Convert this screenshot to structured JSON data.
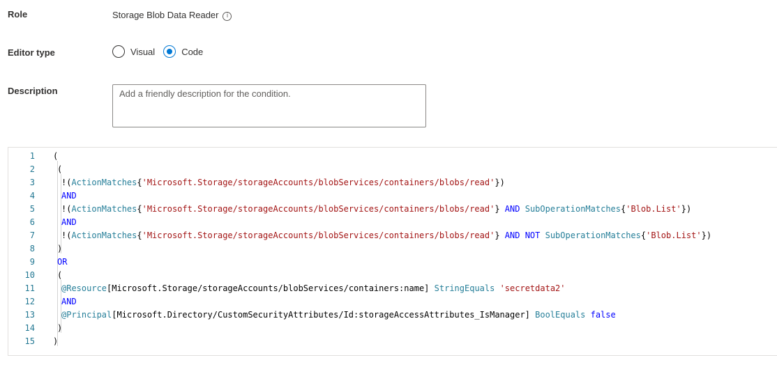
{
  "role": {
    "label": "Role",
    "value": "Storage Blob Data Reader",
    "info_icon": "info-icon"
  },
  "editor_type": {
    "label": "Editor type",
    "options": [
      "Visual",
      "Code"
    ],
    "selected": "Code"
  },
  "description": {
    "label": "Description",
    "placeholder": "Add a friendly description for the condition.",
    "value": ""
  },
  "code_editor": {
    "lines": [
      {
        "n": "1",
        "indent": 0,
        "tokens": [
          [
            "pun",
            "("
          ]
        ]
      },
      {
        "n": "2",
        "indent": 1,
        "tokens": [
          [
            "pun",
            "("
          ]
        ]
      },
      {
        "n": "3",
        "indent": 2,
        "tokens": [
          [
            "pun",
            "!("
          ],
          [
            "fn",
            "ActionMatches"
          ],
          [
            "pun",
            "{"
          ],
          [
            "str",
            "'Microsoft.Storage/storageAccounts/blobServices/containers/blobs/read'"
          ],
          [
            "pun",
            "})"
          ]
        ]
      },
      {
        "n": "4",
        "indent": 2,
        "tokens": [
          [
            "kw",
            "AND"
          ]
        ]
      },
      {
        "n": "5",
        "indent": 2,
        "tokens": [
          [
            "pun",
            "!("
          ],
          [
            "fn",
            "ActionMatches"
          ],
          [
            "pun",
            "{"
          ],
          [
            "str",
            "'Microsoft.Storage/storageAccounts/blobServices/containers/blobs/read'"
          ],
          [
            "pun",
            "} "
          ],
          [
            "kw",
            "AND"
          ],
          [
            "pun",
            " "
          ],
          [
            "fn",
            "SubOperationMatches"
          ],
          [
            "pun",
            "{"
          ],
          [
            "str",
            "'Blob.List'"
          ],
          [
            "pun",
            "})"
          ]
        ]
      },
      {
        "n": "6",
        "indent": 2,
        "tokens": [
          [
            "kw",
            "AND"
          ]
        ]
      },
      {
        "n": "7",
        "indent": 2,
        "tokens": [
          [
            "pun",
            "!("
          ],
          [
            "fn",
            "ActionMatches"
          ],
          [
            "pun",
            "{"
          ],
          [
            "str",
            "'Microsoft.Storage/storageAccounts/blobServices/containers/blobs/read'"
          ],
          [
            "pun",
            "} "
          ],
          [
            "kw",
            "AND NOT"
          ],
          [
            "pun",
            " "
          ],
          [
            "fn",
            "SubOperationMatches"
          ],
          [
            "pun",
            "{"
          ],
          [
            "str",
            "'Blob.List'"
          ],
          [
            "pun",
            "})"
          ]
        ]
      },
      {
        "n": "8",
        "indent": 1,
        "tokens": [
          [
            "pun",
            ")"
          ]
        ]
      },
      {
        "n": "9",
        "indent": 1,
        "tokens": [
          [
            "kw",
            "OR"
          ]
        ]
      },
      {
        "n": "10",
        "indent": 1,
        "tokens": [
          [
            "pun",
            "("
          ]
        ]
      },
      {
        "n": "11",
        "indent": 2,
        "tokens": [
          [
            "attr",
            "@Resource"
          ],
          [
            "pun",
            "[Microsoft.Storage/storageAccounts/blobServices/containers:name] "
          ],
          [
            "fn",
            "StringEquals"
          ],
          [
            "pun",
            " "
          ],
          [
            "str",
            "'secretdata2'"
          ]
        ]
      },
      {
        "n": "12",
        "indent": 2,
        "tokens": [
          [
            "kw",
            "AND"
          ]
        ]
      },
      {
        "n": "13",
        "indent": 2,
        "tokens": [
          [
            "attr",
            "@Principal"
          ],
          [
            "pun",
            "[Microsoft.Directory/CustomSecurityAttributes/Id:storageAccessAttributes_IsManager] "
          ],
          [
            "fn",
            "BoolEquals"
          ],
          [
            "pun",
            " "
          ],
          [
            "kw",
            "false"
          ]
        ]
      },
      {
        "n": "14",
        "indent": 1,
        "tokens": [
          [
            "pun",
            ")"
          ]
        ]
      },
      {
        "n": "15",
        "indent": 0,
        "tokens": [
          [
            "pun",
            ")"
          ]
        ]
      }
    ]
  }
}
